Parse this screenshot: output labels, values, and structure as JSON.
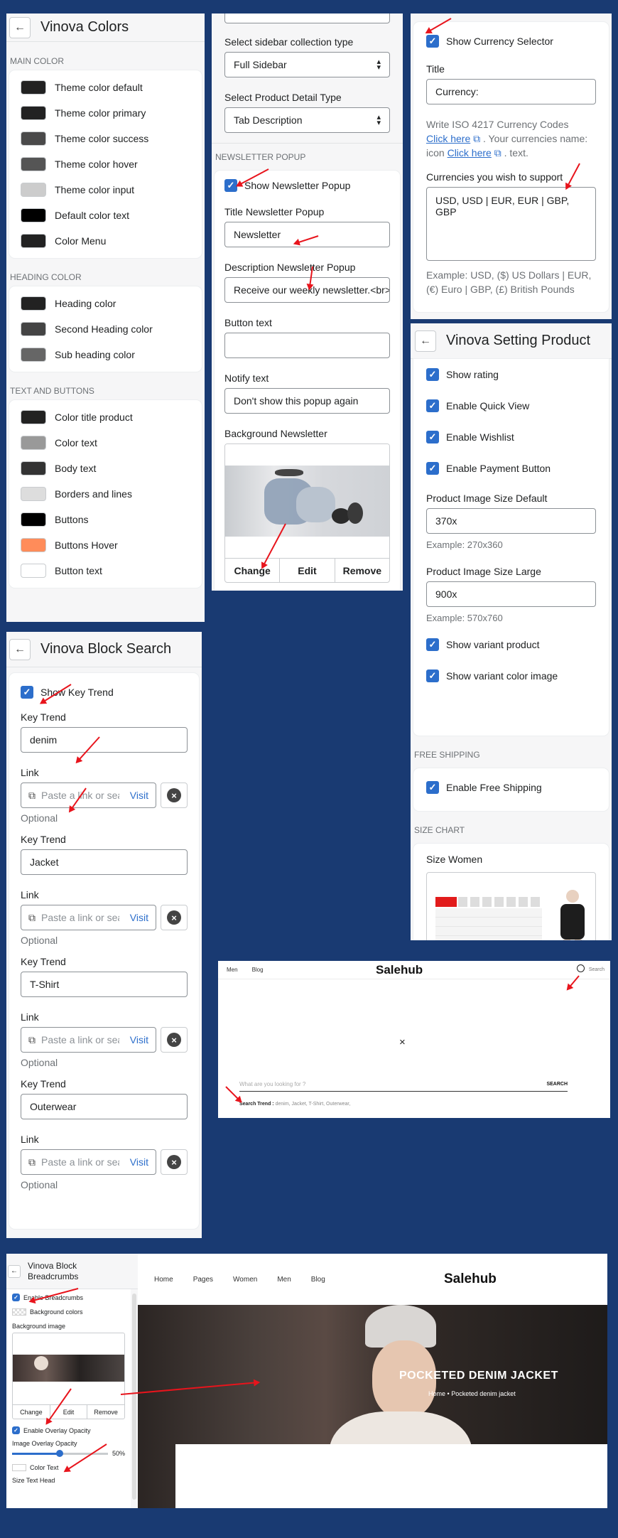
{
  "colors_panel": {
    "title": "Vinova Colors",
    "sections": [
      {
        "heading": "MAIN COLOR",
        "items": [
          {
            "label": "Theme color default",
            "color": "#222222"
          },
          {
            "label": "Theme color primary",
            "color": "#222222"
          },
          {
            "label": "Theme color success",
            "color": "#4a4a4a"
          },
          {
            "label": "Theme color hover",
            "color": "#555555"
          },
          {
            "label": "Theme color input",
            "color": "#cccccc"
          },
          {
            "label": "Default color text",
            "color": "#000000"
          },
          {
            "label": "Color Menu",
            "color": "#222222"
          }
        ]
      },
      {
        "heading": "HEADING COLOR",
        "items": [
          {
            "label": "Heading color",
            "color": "#222222"
          },
          {
            "label": "Second Heading color",
            "color": "#444444"
          },
          {
            "label": "Sub heading color",
            "color": "#666666"
          }
        ]
      },
      {
        "heading": "TEXT AND BUTTONS",
        "items": [
          {
            "label": "Color title product",
            "color": "#222222"
          },
          {
            "label": "Color text",
            "color": "#999999"
          },
          {
            "label": "Body text",
            "color": "#333333"
          },
          {
            "label": "Borders and lines",
            "color": "#dddddd"
          },
          {
            "label": "Buttons",
            "color": "#000000"
          },
          {
            "label": "Buttons Hover",
            "color": "#ff8c5a"
          },
          {
            "label": "Button text",
            "color": "#ffffff"
          }
        ]
      }
    ]
  },
  "sidebar_panel": {
    "collection_label": "Select sidebar collection type",
    "collection_value": "Full Sidebar",
    "detail_label": "Select Product Detail Type",
    "detail_value": "Tab Description",
    "section_heading": "NEWSLETTER POPUP",
    "show_popup_label": "Show Newsletter Popup",
    "title_label": "Title Newsletter Popup",
    "title_value": "Newsletter",
    "desc_label": "Description Newsletter Popup",
    "desc_value": "Receive our weekly newsletter.<br>",
    "button_text_label": "Button text",
    "button_text_value": "",
    "notify_label": "Notify text",
    "notify_value": "Don't show this popup again",
    "bg_label": "Background Newsletter",
    "btn_change": "Change",
    "btn_edit": "Edit",
    "btn_remove": "Remove"
  },
  "currency_panel": {
    "show_label": "Show Currency Selector",
    "title_label": "Title",
    "title_value": "Currency:",
    "help_1": "Write ISO 4217 Currency Codes",
    "click_here_1": "Click here",
    "help_2": ". Your currencies name:",
    "help_3": "icon",
    "click_here_2": "Click here",
    "help_4": ". text.",
    "support_label": "Currencies you wish to support",
    "support_value": "USD, USD | EUR, EUR | GBP, GBP",
    "example": "Example: USD, ($) US Dollars | EUR, (€) Euro | GBP, (£) British Pounds"
  },
  "product_panel": {
    "title": "Vinova Setting Product",
    "checks": [
      "Show rating",
      "Enable Quick View",
      "Enable Wishlist",
      "Enable Payment Button"
    ],
    "size_default_label": "Product Image Size Default",
    "size_default_value": "370x",
    "size_default_example": "Example: 270x360",
    "size_large_label": "Product Image Size Large",
    "size_large_value": "900x",
    "size_large_example": "Example: 570x760",
    "checks2": [
      "Show variant product",
      "Show variant color image"
    ],
    "free_heading": "FREE SHIPPING",
    "free_label": "Enable Free Shipping",
    "size_heading": "SIZE CHART",
    "size_women": "Size Women"
  },
  "search_panel": {
    "title": "Vinova Block Search",
    "show_label": "Show Key Trend",
    "key_label": "Key Trend",
    "link_label": "Link",
    "link_placeholder": "Paste a link or search",
    "visit": "Visit",
    "optional": "Optional",
    "trends": [
      "denim",
      "Jacket",
      "T-Shirt",
      "Outerwear"
    ]
  },
  "search_preview": {
    "nav": [
      "Men",
      "Blog"
    ],
    "logo": "Salehub",
    "search_label": "Search",
    "close": "×",
    "placeholder": "What are you looking for ?",
    "search_btn": "SEARCH",
    "trend_label": "Search Trend :",
    "trend_values": "denim, Jacket, T-Shirt, Outerwear,"
  },
  "breadcrumbs_panel": {
    "title": "Vinova Block Breadcrumbs",
    "enable_label": "Enable Breadcrumbs",
    "bg_colors": "Background colors",
    "bg_image": "Background image",
    "btn_change": "Change",
    "btn_edit": "Edit",
    "btn_remove": "Remove",
    "overlay_label": "Enable Overlay Opacity",
    "opacity_label": "Image Overlay Opacity",
    "opacity_value": "50%",
    "opacity": 0.5,
    "color_text": "Color Text",
    "size_text": "Size Text Head"
  },
  "breadcrumbs_preview": {
    "nav": [
      "Home",
      "Pages",
      "Women",
      "Men",
      "Blog"
    ],
    "logo": "Salehub",
    "hero_title": "POCKETED DENIM JACKET",
    "crumb_home": "Home",
    "crumb_sep": "•",
    "crumb_current": "Pocketed denim jacket"
  }
}
